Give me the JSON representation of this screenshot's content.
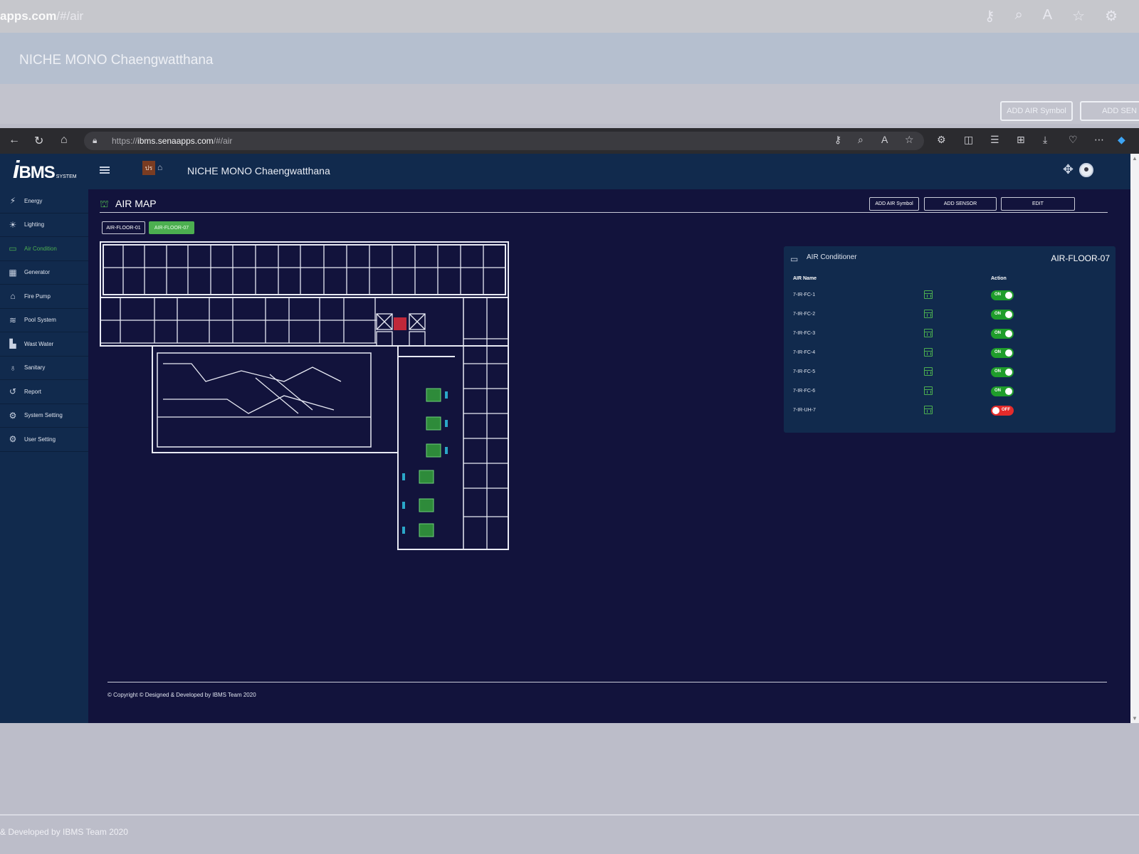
{
  "background": {
    "url_host": "apps.com",
    "url_path": "/#/air",
    "title": "NICHE MONO Chaengwatthana",
    "buttons": [
      "ADD AIR Symbol",
      "ADD SEN"
    ],
    "footer": "& Developed by IBMS Team 2020"
  },
  "browser": {
    "url_prefix": "https://",
    "url_host": "ibms.senaapps.com",
    "url_path": "/#/air"
  },
  "app": {
    "logo_i": "i",
    "logo_text": "BMS",
    "logo_sub": "SYSTEM",
    "brand_mark": "ปร",
    "page_title": "NICHE MONO Chaengwatthana",
    "accent": "#4caf50"
  },
  "sidebar": {
    "items": [
      {
        "label": "Energy",
        "icon": "bolt-icon",
        "active": false
      },
      {
        "label": "Lighting",
        "icon": "bulb-icon",
        "active": false
      },
      {
        "label": "Air Condition",
        "icon": "air-conditioner-icon",
        "active": true
      },
      {
        "label": "Generator",
        "icon": "generator-icon",
        "active": false
      },
      {
        "label": "Fire Pump",
        "icon": "fire-pump-icon",
        "active": false
      },
      {
        "label": "Pool System",
        "icon": "pool-icon",
        "active": false
      },
      {
        "label": "Wast Water",
        "icon": "water-icon",
        "active": false
      },
      {
        "label": "Sanitary",
        "icon": "sanitary-icon",
        "active": false
      },
      {
        "label": "Report",
        "icon": "history-icon",
        "active": false
      },
      {
        "label": "System Setting",
        "icon": "settings-icon",
        "active": false
      },
      {
        "label": "User Setting",
        "icon": "user-settings-icon",
        "active": false
      }
    ]
  },
  "airmap": {
    "title": "AIR MAP",
    "buttons": {
      "add_air": "ADD AIR Symbol",
      "add_sensor": "ADD SENSOR",
      "edit": "EDIT"
    },
    "tabs": [
      {
        "label": "AIR-FLOOR-01",
        "active": false
      },
      {
        "label": "AIR-FLOOR-07",
        "active": true
      }
    ]
  },
  "panel": {
    "title": "AIR Conditioner",
    "floor": "AIR-FLOOR-07",
    "col_name": "AIR Name",
    "col_action": "Action",
    "rows": [
      {
        "name": "7-IR-FC-1",
        "state": "ON"
      },
      {
        "name": "7-IR-FC-2",
        "state": "ON"
      },
      {
        "name": "7-IR-FC-3",
        "state": "ON"
      },
      {
        "name": "7-IR-FC-4",
        "state": "ON"
      },
      {
        "name": "7-IR-FC-5",
        "state": "ON"
      },
      {
        "name": "7-IR-FC-6",
        "state": "ON"
      },
      {
        "name": "7-IR-UH-7",
        "state": "OFF"
      }
    ]
  },
  "footer": {
    "copyright": "© Copyright © Designed & Developed by IBMS Team 2020"
  }
}
